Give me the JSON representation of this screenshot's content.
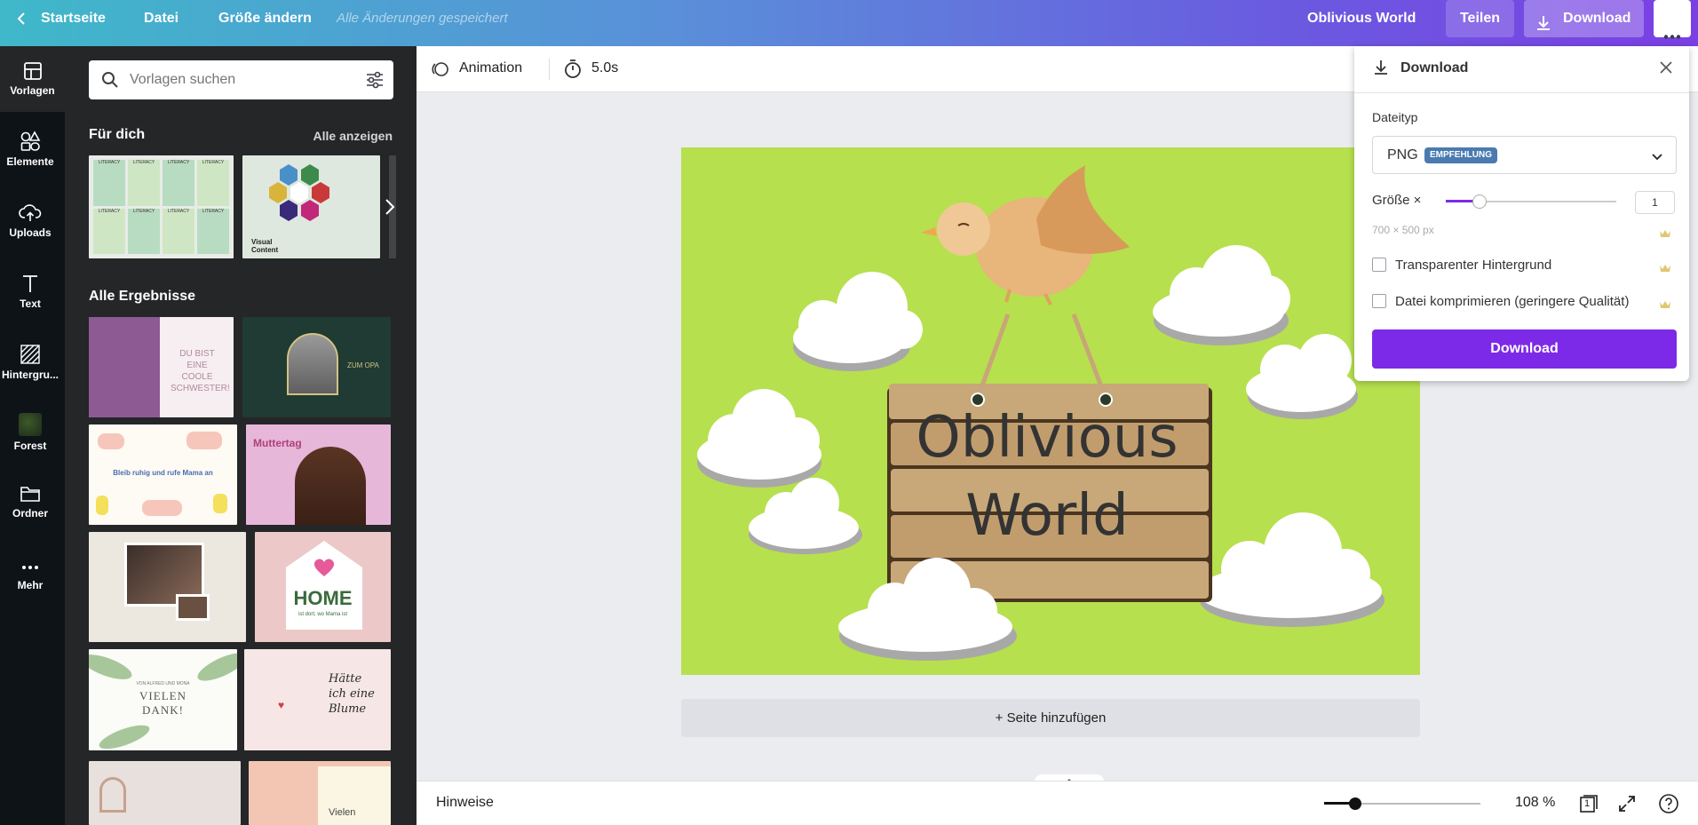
{
  "topbar": {
    "home": "Startseite",
    "file": "Datei",
    "resize": "Größe ändern",
    "saved_status": "Alle Änderungen gespeichert",
    "doc_title": "Oblivious World",
    "share": "Teilen",
    "download": "Download",
    "more": "more-icon"
  },
  "rail": {
    "items": [
      {
        "label": "Vorlagen",
        "icon": "templates-icon"
      },
      {
        "label": "Elemente",
        "icon": "elements-icon"
      },
      {
        "label": "Uploads",
        "icon": "upload-cloud-icon"
      },
      {
        "label": "Text",
        "icon": "text-icon"
      },
      {
        "label": "Hintergru...",
        "icon": "background-icon"
      },
      {
        "label": "Forest",
        "icon": "forest-thumb"
      },
      {
        "label": "Ordner",
        "icon": "folder-icon"
      },
      {
        "label": "Mehr",
        "icon": "more-icon"
      }
    ]
  },
  "panel": {
    "search_placeholder": "Vorlagen suchen",
    "for_you": "Für dich",
    "see_all": "Alle anzeigen",
    "all_results": "Alle Ergebnisse",
    "thumb_texts": {
      "literacy": "LITERACY",
      "visual_content": "Visual Content",
      "cool_sister": "DU BIST EINE COOLE SCHWESTER!",
      "zum_opa": "ZUM OPA",
      "mama": "Bleib ruhig und rufe Mama an",
      "muttertag": "Muttertag",
      "home": "HOME",
      "home_sub": "ist dort, wo Mama ist",
      "vielen_dank": "VIELEN DANK!",
      "vielen_dank_sub": "VON ALFRED UND MONA",
      "blume": "Hätte ich eine Blume",
      "vielen": "Vielen"
    }
  },
  "toolbar": {
    "animation": "Animation",
    "duration": "5.0s"
  },
  "canvas": {
    "line1": "Oblivious",
    "line2": "World",
    "bg_color": "#b6e04e",
    "add_page": "+ Seite hinzufügen"
  },
  "bottombar": {
    "notes": "Hinweise",
    "zoom": "108 %",
    "zoom_fraction": 0.2,
    "page_count": "1"
  },
  "download_panel": {
    "title": "Download",
    "filetype_label": "Dateityp",
    "filetype_value": "PNG",
    "recommend_badge": "EMPFEHLUNG",
    "size_label": "Größe ×",
    "size_value": "1",
    "size_fraction": 0.2,
    "dimensions": "700 × 500 px",
    "transparent_bg": "Transparenter Hintergrund",
    "compress": "Datei komprimieren (geringere Qualität)",
    "download_button": "Download",
    "accent": "#7d2ae8"
  }
}
